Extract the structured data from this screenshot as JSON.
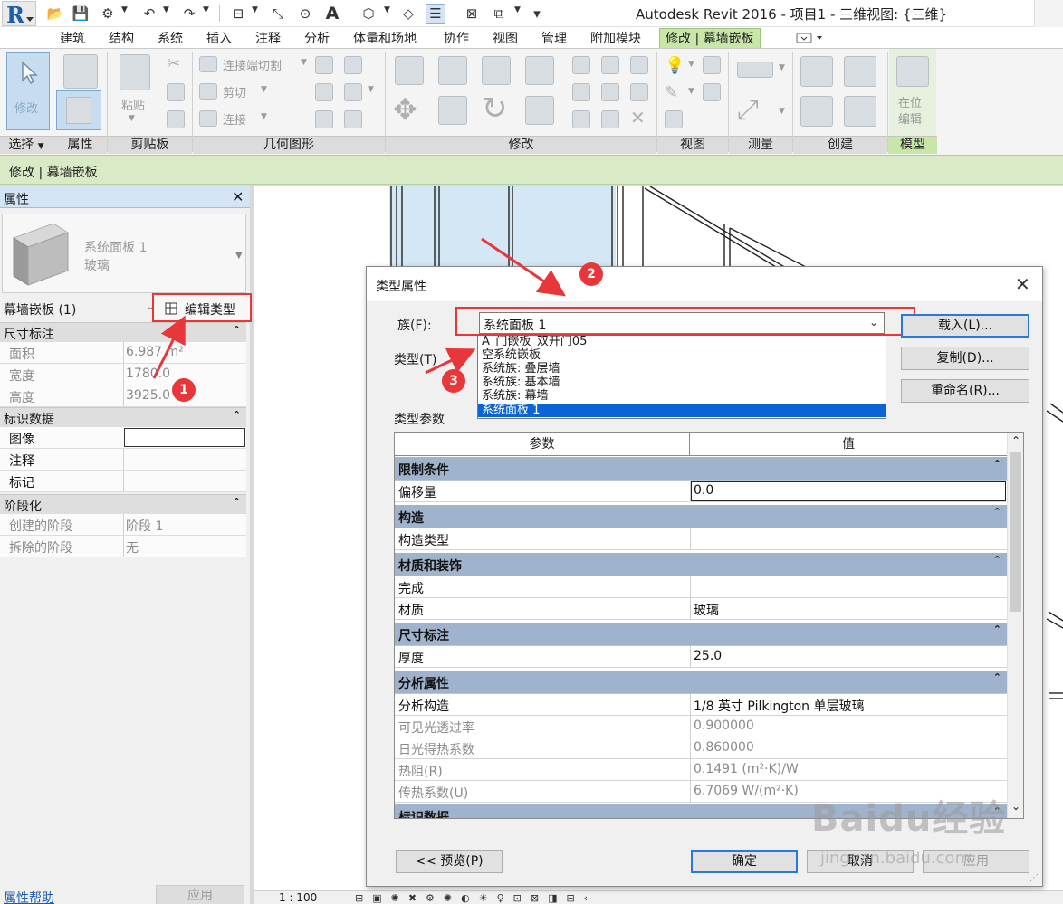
{
  "title_bar": {
    "title": "Autodesk Revit 2016 -      项目1 - 三维视图: {三维}",
    "text_tool": "A"
  },
  "ribbon_tabs": [
    {
      "label": "建筑",
      "active": false
    },
    {
      "label": "结构",
      "active": false
    },
    {
      "label": "系统",
      "active": false
    },
    {
      "label": "插入",
      "active": false
    },
    {
      "label": "注释",
      "active": false
    },
    {
      "label": "分析",
      "active": false
    },
    {
      "label": "体量和场地",
      "active": false
    },
    {
      "label": "协作",
      "active": false
    },
    {
      "label": "视图",
      "active": false
    },
    {
      "label": "管理",
      "active": false
    },
    {
      "label": "附加模块",
      "active": false
    },
    {
      "label": "修改 | 幕墙嵌板",
      "active": true
    }
  ],
  "ribbon": {
    "modify_label": "修改",
    "paste_label": "粘贴",
    "join_cut_label": "连接端切割",
    "cut_label": "剪切",
    "join_label": "连接",
    "inplace_label": "在位\n编辑",
    "panels": [
      "选择",
      "属性",
      "剪贴板",
      "几何图形",
      "修改",
      "视图",
      "测量",
      "创建",
      "模型"
    ]
  },
  "context_bar": {
    "label": "修改 | 幕墙嵌板"
  },
  "properties": {
    "title": "属性",
    "type_name_line1": "系统面板 1",
    "type_name_line2": "玻璃",
    "instance_selector": "幕墙嵌板 (1)",
    "edit_type_label": "编辑类型",
    "groups": [
      {
        "name": "尺寸标注",
        "rows": [
          {
            "key": "面积",
            "value": "6.987 m²",
            "dim": true
          },
          {
            "key": "宽度",
            "value": "1780.0",
            "dim": true
          },
          {
            "key": "高度",
            "value": "3925.0",
            "dim": true
          }
        ]
      },
      {
        "name": "标识数据",
        "rows": [
          {
            "key": "图像",
            "value": "",
            "dim": false
          },
          {
            "key": "注释",
            "value": "",
            "dim": false
          },
          {
            "key": "标记",
            "value": "",
            "dim": false
          }
        ]
      },
      {
        "name": "阶段化",
        "rows": [
          {
            "key": "创建的阶段",
            "value": "阶段 1",
            "dim": true
          },
          {
            "key": "拆除的阶段",
            "value": "无",
            "dim": true
          }
        ]
      }
    ],
    "help_link": "属性帮助",
    "apply_button": "应用"
  },
  "status_bar": {
    "scale": "1 : 100"
  },
  "dialog": {
    "title": "类型属性",
    "family_label": "族(F):",
    "family_value": "系统面板 1",
    "type_label": "类型(T)",
    "family_options": [
      {
        "label": "A_门嵌板_双开门05",
        "selected": false
      },
      {
        "label": "空系统嵌板",
        "selected": false
      },
      {
        "label": "系统族: 叠层墙",
        "selected": false
      },
      {
        "label": "系统族: 基本墙",
        "selected": false
      },
      {
        "label": "系统族: 幕墙",
        "selected": false
      },
      {
        "label": "系统面板 1",
        "selected": true
      }
    ],
    "buttons": {
      "load": "载入(L)...",
      "duplicate": "复制(D)...",
      "rename": "重命名(R)...",
      "preview": "<< 预览(P)",
      "ok": "确定",
      "cancel": "取消",
      "apply": "应用"
    },
    "type_params_label": "类型参数",
    "columns": {
      "param": "参数",
      "value": "值"
    },
    "param_groups": [
      {
        "name": "限制条件",
        "rows": [
          {
            "key": "偏移量",
            "value": "0.0",
            "gray": false
          }
        ]
      },
      {
        "name": "构造",
        "rows": [
          {
            "key": "构造类型",
            "value": "",
            "gray": false
          }
        ]
      },
      {
        "name": "材质和装饰",
        "rows": [
          {
            "key": "完成",
            "value": "",
            "gray": false
          },
          {
            "key": "材质",
            "value": "玻璃",
            "gray": false
          }
        ]
      },
      {
        "name": "尺寸标注",
        "rows": [
          {
            "key": "厚度",
            "value": "25.0",
            "gray": false
          }
        ]
      },
      {
        "name": "分析属性",
        "rows": [
          {
            "key": "分析构造",
            "value": "1/8 英寸 Pilkington 单层玻璃",
            "gray": false
          },
          {
            "key": "可见光透过率",
            "value": "0.900000",
            "gray": true
          },
          {
            "key": "日光得热系数",
            "value": "0.860000",
            "gray": true
          },
          {
            "key": "热阻(R)",
            "value": "0.1491 (m²·K)/W",
            "gray": true
          },
          {
            "key": "传热系数(U)",
            "value": "6.7069 W/(m²·K)",
            "gray": true
          }
        ]
      },
      {
        "name": "标识数据",
        "rows": []
      }
    ]
  },
  "annotations": {
    "markers": [
      "1",
      "2",
      "3"
    ]
  },
  "watermark": {
    "main": "Baidu经验",
    "sub": "jingyan.baidu.com"
  },
  "colors": {
    "accent_red": "#e8363a",
    "context_green": "#d8eac6",
    "group_blue": "#9fb4cc",
    "selection_blue": "#0a64d4"
  }
}
